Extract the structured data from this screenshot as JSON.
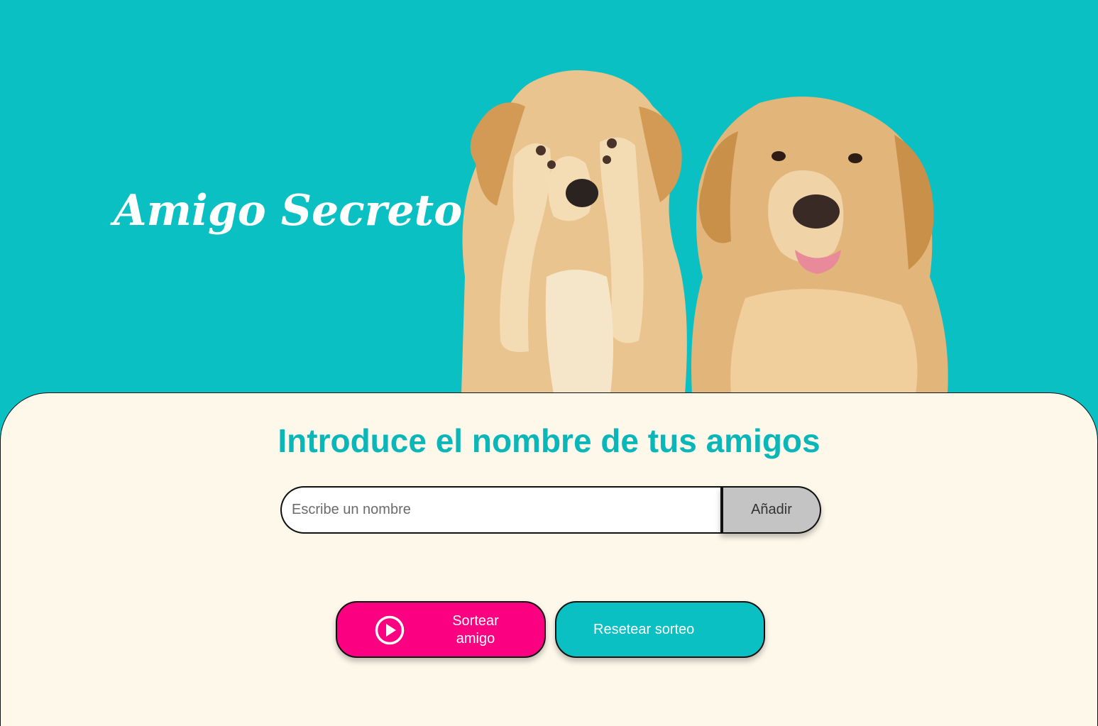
{
  "header": {
    "title": "Amigo Secreto"
  },
  "main": {
    "subtitle": "Introduce el nombre de tus amigos",
    "name_input_placeholder": "Escribe un nombre",
    "name_input_value": "",
    "add_label": "Añadir",
    "draw_label": "Sortear amigo",
    "reset_label": "Resetear sorteo"
  },
  "icons": {
    "draw": "play-circle-icon",
    "illustration": "two-golden-retriever-dogs"
  },
  "colors": {
    "teal": "#0bc0c3",
    "cream": "#fdf8ea",
    "pink": "#fb0080",
    "gray": "#c4c4c4"
  }
}
